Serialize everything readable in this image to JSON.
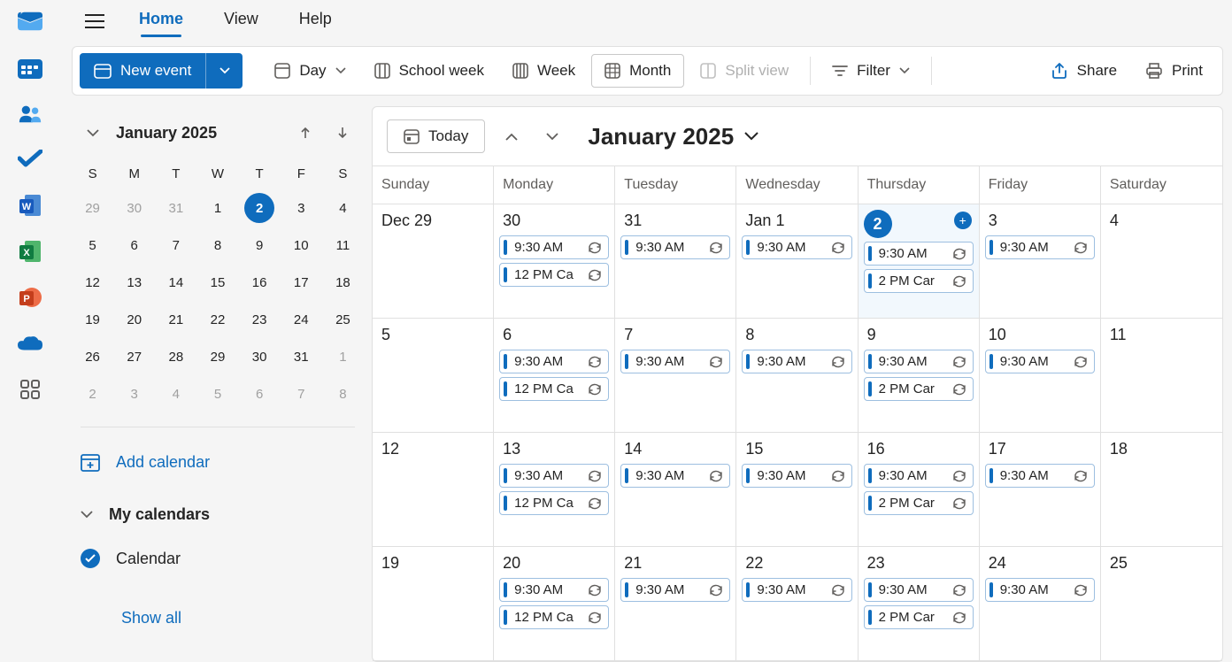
{
  "rail": {
    "apps": [
      "mail",
      "calendar",
      "people",
      "todo",
      "word",
      "excel",
      "powerpoint",
      "onedrive",
      "more-apps"
    ]
  },
  "titlebar": {
    "tabs": [
      "Home",
      "View",
      "Help"
    ],
    "active": "Home"
  },
  "toolbar": {
    "new_event": "New event",
    "day": "Day",
    "school_week": "School week",
    "week": "Week",
    "month": "Month",
    "split_view": "Split view",
    "filter": "Filter",
    "share": "Share",
    "print": "Print"
  },
  "mini_cal": {
    "title": "January 2025",
    "day_headers": [
      "S",
      "M",
      "T",
      "W",
      "T",
      "F",
      "S"
    ],
    "rows": [
      [
        {
          "d": "29",
          "dim": true
        },
        {
          "d": "30",
          "dim": true
        },
        {
          "d": "31",
          "dim": true
        },
        {
          "d": "1"
        },
        {
          "d": "2",
          "today": true
        },
        {
          "d": "3"
        },
        {
          "d": "4"
        }
      ],
      [
        {
          "d": "5"
        },
        {
          "d": "6"
        },
        {
          "d": "7"
        },
        {
          "d": "8"
        },
        {
          "d": "9"
        },
        {
          "d": "10"
        },
        {
          "d": "11"
        }
      ],
      [
        {
          "d": "12"
        },
        {
          "d": "13"
        },
        {
          "d": "14"
        },
        {
          "d": "15"
        },
        {
          "d": "16"
        },
        {
          "d": "17"
        },
        {
          "d": "18"
        }
      ],
      [
        {
          "d": "19"
        },
        {
          "d": "20"
        },
        {
          "d": "21"
        },
        {
          "d": "22"
        },
        {
          "d": "23"
        },
        {
          "d": "24"
        },
        {
          "d": "25"
        }
      ],
      [
        {
          "d": "26"
        },
        {
          "d": "27"
        },
        {
          "d": "28"
        },
        {
          "d": "29"
        },
        {
          "d": "30"
        },
        {
          "d": "31"
        },
        {
          "d": "1",
          "dim": true
        }
      ],
      [
        {
          "d": "2",
          "dim": true
        },
        {
          "d": "3",
          "dim": true
        },
        {
          "d": "4",
          "dim": true
        },
        {
          "d": "5",
          "dim": true
        },
        {
          "d": "6",
          "dim": true
        },
        {
          "d": "7",
          "dim": true
        },
        {
          "d": "8",
          "dim": true
        }
      ]
    ]
  },
  "sidebar": {
    "add_calendar": "Add calendar",
    "my_calendars": "My calendars",
    "calendar_item": "Calendar",
    "show_all": "Show all"
  },
  "main": {
    "today": "Today",
    "title": "January 2025",
    "day_headers": [
      "Sunday",
      "Monday",
      "Tuesday",
      "Wednesday",
      "Thursday",
      "Friday",
      "Saturday"
    ],
    "weeks": [
      [
        {
          "date": "Dec 29",
          "events": []
        },
        {
          "date": "30",
          "events": [
            {
              "t": "9:30 AM "
            },
            {
              "t": "12 PM Ca"
            }
          ]
        },
        {
          "date": "31",
          "events": [
            {
              "t": "9:30 AM "
            }
          ]
        },
        {
          "date": "Jan 1",
          "events": [
            {
              "t": "9:30 AM "
            }
          ]
        },
        {
          "date": "2",
          "today": true,
          "add": true,
          "events": [
            {
              "t": "9:30 AM "
            },
            {
              "t": "2 PM Car"
            }
          ]
        },
        {
          "date": "3",
          "events": [
            {
              "t": "9:30 AM "
            }
          ]
        },
        {
          "date": "4",
          "events": []
        }
      ],
      [
        {
          "date": "5",
          "events": []
        },
        {
          "date": "6",
          "events": [
            {
              "t": "9:30 AM "
            },
            {
              "t": "12 PM Ca"
            }
          ]
        },
        {
          "date": "7",
          "events": [
            {
              "t": "9:30 AM "
            }
          ]
        },
        {
          "date": "8",
          "events": [
            {
              "t": "9:30 AM "
            }
          ]
        },
        {
          "date": "9",
          "events": [
            {
              "t": "9:30 AM "
            },
            {
              "t": "2 PM Car"
            }
          ]
        },
        {
          "date": "10",
          "events": [
            {
              "t": "9:30 AM "
            }
          ]
        },
        {
          "date": "11",
          "events": []
        }
      ],
      [
        {
          "date": "12",
          "events": []
        },
        {
          "date": "13",
          "events": [
            {
              "t": "9:30 AM "
            },
            {
              "t": "12 PM Ca"
            }
          ]
        },
        {
          "date": "14",
          "events": [
            {
              "t": "9:30 AM "
            }
          ]
        },
        {
          "date": "15",
          "events": [
            {
              "t": "9:30 AM "
            }
          ]
        },
        {
          "date": "16",
          "events": [
            {
              "t": "9:30 AM "
            },
            {
              "t": "2 PM Car"
            }
          ]
        },
        {
          "date": "17",
          "events": [
            {
              "t": "9:30 AM "
            }
          ]
        },
        {
          "date": "18",
          "events": []
        }
      ],
      [
        {
          "date": "19",
          "events": []
        },
        {
          "date": "20",
          "events": [
            {
              "t": "9:30 AM "
            },
            {
              "t": "12 PM Ca"
            }
          ]
        },
        {
          "date": "21",
          "events": [
            {
              "t": "9:30 AM "
            }
          ]
        },
        {
          "date": "22",
          "events": [
            {
              "t": "9:30 AM "
            }
          ]
        },
        {
          "date": "23",
          "events": [
            {
              "t": "9:30 AM "
            },
            {
              "t": "2 PM Car"
            }
          ]
        },
        {
          "date": "24",
          "events": [
            {
              "t": "9:30 AM "
            }
          ]
        },
        {
          "date": "25",
          "events": []
        }
      ]
    ]
  }
}
